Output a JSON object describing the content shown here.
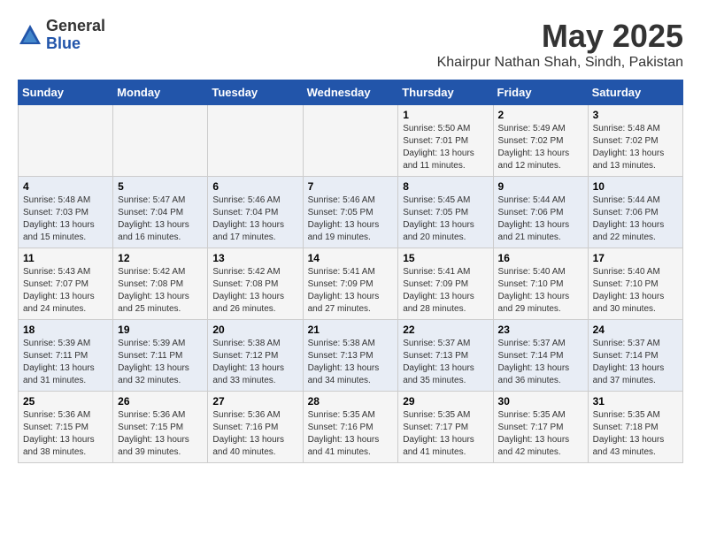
{
  "logo": {
    "general": "General",
    "blue": "Blue"
  },
  "header": {
    "month_year": "May 2025",
    "location": "Khairpur Nathan Shah, Sindh, Pakistan"
  },
  "weekdays": [
    "Sunday",
    "Monday",
    "Tuesday",
    "Wednesday",
    "Thursday",
    "Friday",
    "Saturday"
  ],
  "weeks": [
    [
      {
        "day": "",
        "info": ""
      },
      {
        "day": "",
        "info": ""
      },
      {
        "day": "",
        "info": ""
      },
      {
        "day": "",
        "info": ""
      },
      {
        "day": "1",
        "info": "Sunrise: 5:50 AM\nSunset: 7:01 PM\nDaylight: 13 hours\nand 11 minutes."
      },
      {
        "day": "2",
        "info": "Sunrise: 5:49 AM\nSunset: 7:02 PM\nDaylight: 13 hours\nand 12 minutes."
      },
      {
        "day": "3",
        "info": "Sunrise: 5:48 AM\nSunset: 7:02 PM\nDaylight: 13 hours\nand 13 minutes."
      }
    ],
    [
      {
        "day": "4",
        "info": "Sunrise: 5:48 AM\nSunset: 7:03 PM\nDaylight: 13 hours\nand 15 minutes."
      },
      {
        "day": "5",
        "info": "Sunrise: 5:47 AM\nSunset: 7:04 PM\nDaylight: 13 hours\nand 16 minutes."
      },
      {
        "day": "6",
        "info": "Sunrise: 5:46 AM\nSunset: 7:04 PM\nDaylight: 13 hours\nand 17 minutes."
      },
      {
        "day": "7",
        "info": "Sunrise: 5:46 AM\nSunset: 7:05 PM\nDaylight: 13 hours\nand 19 minutes."
      },
      {
        "day": "8",
        "info": "Sunrise: 5:45 AM\nSunset: 7:05 PM\nDaylight: 13 hours\nand 20 minutes."
      },
      {
        "day": "9",
        "info": "Sunrise: 5:44 AM\nSunset: 7:06 PM\nDaylight: 13 hours\nand 21 minutes."
      },
      {
        "day": "10",
        "info": "Sunrise: 5:44 AM\nSunset: 7:06 PM\nDaylight: 13 hours\nand 22 minutes."
      }
    ],
    [
      {
        "day": "11",
        "info": "Sunrise: 5:43 AM\nSunset: 7:07 PM\nDaylight: 13 hours\nand 24 minutes."
      },
      {
        "day": "12",
        "info": "Sunrise: 5:42 AM\nSunset: 7:08 PM\nDaylight: 13 hours\nand 25 minutes."
      },
      {
        "day": "13",
        "info": "Sunrise: 5:42 AM\nSunset: 7:08 PM\nDaylight: 13 hours\nand 26 minutes."
      },
      {
        "day": "14",
        "info": "Sunrise: 5:41 AM\nSunset: 7:09 PM\nDaylight: 13 hours\nand 27 minutes."
      },
      {
        "day": "15",
        "info": "Sunrise: 5:41 AM\nSunset: 7:09 PM\nDaylight: 13 hours\nand 28 minutes."
      },
      {
        "day": "16",
        "info": "Sunrise: 5:40 AM\nSunset: 7:10 PM\nDaylight: 13 hours\nand 29 minutes."
      },
      {
        "day": "17",
        "info": "Sunrise: 5:40 AM\nSunset: 7:10 PM\nDaylight: 13 hours\nand 30 minutes."
      }
    ],
    [
      {
        "day": "18",
        "info": "Sunrise: 5:39 AM\nSunset: 7:11 PM\nDaylight: 13 hours\nand 31 minutes."
      },
      {
        "day": "19",
        "info": "Sunrise: 5:39 AM\nSunset: 7:11 PM\nDaylight: 13 hours\nand 32 minutes."
      },
      {
        "day": "20",
        "info": "Sunrise: 5:38 AM\nSunset: 7:12 PM\nDaylight: 13 hours\nand 33 minutes."
      },
      {
        "day": "21",
        "info": "Sunrise: 5:38 AM\nSunset: 7:13 PM\nDaylight: 13 hours\nand 34 minutes."
      },
      {
        "day": "22",
        "info": "Sunrise: 5:37 AM\nSunset: 7:13 PM\nDaylight: 13 hours\nand 35 minutes."
      },
      {
        "day": "23",
        "info": "Sunrise: 5:37 AM\nSunset: 7:14 PM\nDaylight: 13 hours\nand 36 minutes."
      },
      {
        "day": "24",
        "info": "Sunrise: 5:37 AM\nSunset: 7:14 PM\nDaylight: 13 hours\nand 37 minutes."
      }
    ],
    [
      {
        "day": "25",
        "info": "Sunrise: 5:36 AM\nSunset: 7:15 PM\nDaylight: 13 hours\nand 38 minutes."
      },
      {
        "day": "26",
        "info": "Sunrise: 5:36 AM\nSunset: 7:15 PM\nDaylight: 13 hours\nand 39 minutes."
      },
      {
        "day": "27",
        "info": "Sunrise: 5:36 AM\nSunset: 7:16 PM\nDaylight: 13 hours\nand 40 minutes."
      },
      {
        "day": "28",
        "info": "Sunrise: 5:35 AM\nSunset: 7:16 PM\nDaylight: 13 hours\nand 41 minutes."
      },
      {
        "day": "29",
        "info": "Sunrise: 5:35 AM\nSunset: 7:17 PM\nDaylight: 13 hours\nand 41 minutes."
      },
      {
        "day": "30",
        "info": "Sunrise: 5:35 AM\nSunset: 7:17 PM\nDaylight: 13 hours\nand 42 minutes."
      },
      {
        "day": "31",
        "info": "Sunrise: 5:35 AM\nSunset: 7:18 PM\nDaylight: 13 hours\nand 43 minutes."
      }
    ]
  ]
}
